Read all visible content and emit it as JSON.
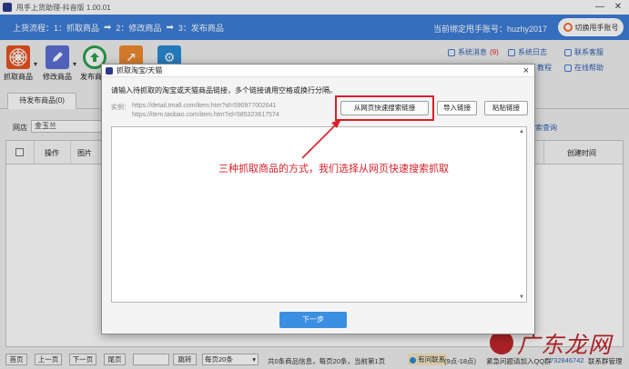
{
  "titlebar": {
    "title": "甩手上货助理-抖音版 1.00.01",
    "minimize": "—",
    "close": "✕"
  },
  "process": {
    "label": "上货流程：",
    "steps": [
      "1：抓取商品",
      "2：修改商品",
      "3：发布商品"
    ],
    "arrow": "➡",
    "bound_text": "当前绑定甩手账号：huzhy2017",
    "switch_account": "切换甩手账号"
  },
  "toolbar": {
    "buttons": [
      {
        "label": "抓取商品",
        "icon": "spider-web-icon",
        "color": "#e8531f"
      },
      {
        "label": "修改商品",
        "icon": "pencil-icon",
        "color": "#5a6fd4"
      },
      {
        "label": "发布商品",
        "icon": "upload-icon",
        "color": "#2aa34a"
      },
      {
        "label": "",
        "icon": "share-icon",
        "color": "#f08a30"
      },
      {
        "label": "",
        "icon": "gear-icon",
        "color": "#2a8ad4"
      }
    ],
    "dropdown_glyph": "▾",
    "right_links": [
      {
        "label": "系统消息",
        "count": "(9)"
      },
      {
        "label": "系统日志",
        "count": ""
      },
      {
        "label": "联系客服",
        "count": ""
      },
      {
        "label": "教程",
        "count": ""
      },
      {
        "label": "在线帮助",
        "count": ""
      }
    ]
  },
  "tabs": {
    "active": "待发布商品(0)"
  },
  "filter": {
    "shop_label": "网店",
    "shop_value": "金玉兰",
    "query": "搜索查询"
  },
  "table": {
    "columns": [
      "操作",
      "图片",
      "创建时间"
    ]
  },
  "pager": {
    "first": "首页",
    "prev": "上一页",
    "next": "下一页",
    "last": "尾页",
    "jump": "跳转",
    "page_size": "每页20条",
    "info": "共0条商品信息，每页20条，当前第1页",
    "contact": "有问联系",
    "hours": "(9点-18点)",
    "qq_label": "紧急问题请加入QQ群",
    "qq_number": "732846742",
    "manage": "联系群管理"
  },
  "dialog": {
    "title": "抓取淘宝/天猫",
    "close": "×",
    "instruction": "请输入待抓取的淘宝或天猫商品链接，多个链接请用空格或换行分隔。",
    "example_label": "实例：",
    "example1": "https://detail.tmall.com/item.htm?id=590977002641",
    "example2": "https://item.taobao.com/item.htm?id=585323617574",
    "search_button": "从网页快速搜索链接",
    "import_button": "导入链接",
    "paste_button": "粘贴链接",
    "next_button": "下一步"
  },
  "annotation": {
    "text": "三种抓取商品的方式，我们选择从网页快速搜索抓取",
    "color": "#d9202a"
  },
  "watermark": {
    "text": "广东龙网"
  }
}
